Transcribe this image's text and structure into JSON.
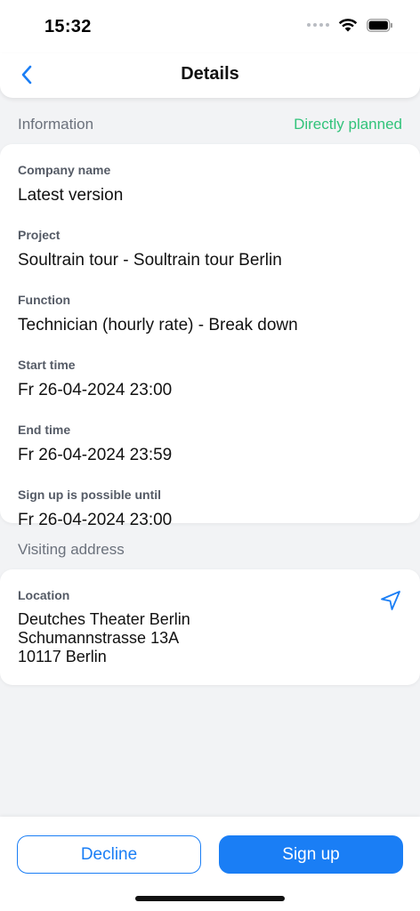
{
  "status_bar": {
    "time": "15:32"
  },
  "nav": {
    "title": "Details"
  },
  "information": {
    "section_label": "Information",
    "status": "Directly planned",
    "status_color": "#31c37a",
    "fields": [
      {
        "label": "Company name",
        "value": "Latest version"
      },
      {
        "label": "Project",
        "value": "Soultrain tour - Soultrain tour Berlin"
      },
      {
        "label": "Function",
        "value": "Technician (hourly rate) - Break down"
      },
      {
        "label": "Start time",
        "value": "Fr 26-04-2024 23:00"
      },
      {
        "label": "End time",
        "value": "Fr 26-04-2024 23:59"
      },
      {
        "label": "Sign up is possible until",
        "value": "Fr 26-04-2024 23:00"
      }
    ]
  },
  "visiting_address": {
    "section_label": "Visiting address",
    "location_label": "Location",
    "lines": [
      "Deutches Theater Berlin",
      "Schumannstrasse 13A",
      "10117 Berlin"
    ]
  },
  "actions": {
    "decline_label": "Decline",
    "signup_label": "Sign up",
    "accent_color": "#1a7ef5"
  },
  "icons": {
    "back": "chevron-left-icon",
    "navigate": "location-arrow-icon",
    "wifi": "wifi-icon",
    "battery": "battery-icon",
    "cellular": "cellular-signal-icon"
  }
}
